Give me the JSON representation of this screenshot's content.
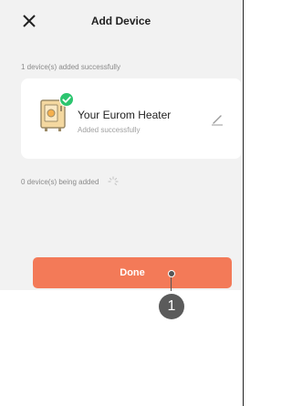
{
  "header": {
    "title": "Add Device",
    "close_icon": "close-icon"
  },
  "status": {
    "success_text": "1 device(s) added successfully",
    "adding_text": "0 device(s) being added"
  },
  "device": {
    "name": "Your Eurom Heater",
    "status": "Added successfully",
    "image_icon": "heater-icon",
    "badge_icon": "check-circle-icon",
    "edit_icon": "pencil-icon"
  },
  "actions": {
    "done_label": "Done"
  },
  "annotation": {
    "marker": "1"
  },
  "colors": {
    "accent": "#f37a58",
    "success": "#2cc56f",
    "background": "#f2f2f2",
    "marker": "#5b5b5b"
  }
}
